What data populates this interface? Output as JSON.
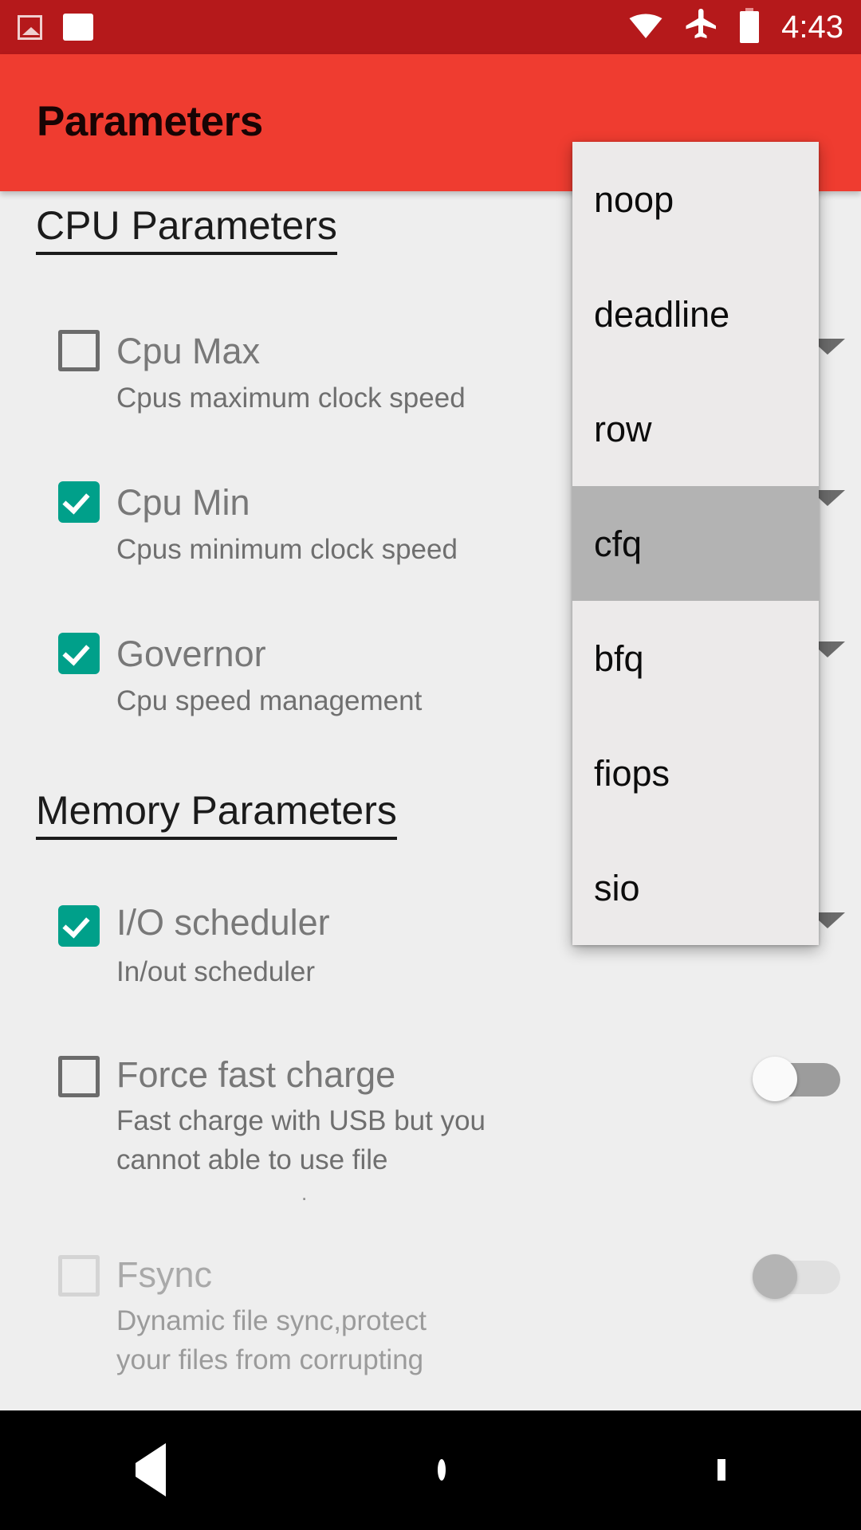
{
  "statusbar": {
    "time": "4:43",
    "icons": [
      "photo-icon",
      "white-square-icon",
      "wifi-icon",
      "airplane-mode-icon",
      "battery-icon"
    ]
  },
  "appbar": {
    "title": "Parameters"
  },
  "sections": [
    {
      "id": "cpu",
      "title": "CPU Parameters",
      "rows": [
        {
          "id": "cpu-max",
          "title": "Cpu Max",
          "subtitle": "Cpus maximum clock speed",
          "checked": false,
          "control": "spinner"
        },
        {
          "id": "cpu-min",
          "title": "Cpu Min",
          "subtitle": "Cpus minimum clock speed",
          "checked": true,
          "control": "spinner"
        },
        {
          "id": "governor",
          "title": "Governor",
          "subtitle": "Cpu speed management",
          "checked": true,
          "control": "spinner"
        }
      ]
    },
    {
      "id": "memory",
      "title": "Memory Parameters",
      "rows": [
        {
          "id": "io-scheduler",
          "title": "I/O scheduler",
          "subtitle": "In/out scheduler",
          "checked": true,
          "control": "spinner"
        },
        {
          "id": "force-fast-charge",
          "title": "Force fast charge",
          "subtitle": "Fast charge with USB but you\ncannot able to use file",
          "extra_dot": ".",
          "checked": false,
          "control": "switch",
          "switch_on": false,
          "switch_enabled": true
        },
        {
          "id": "fsync",
          "title": "Fsync",
          "subtitle": "Dynamic file sync,protect\nyour files from corrupting",
          "checked": false,
          "control": "switch",
          "switch_on": false,
          "switch_enabled": false
        }
      ]
    }
  ],
  "dropdown": {
    "name": "io-scheduler-options",
    "selected": "cfq",
    "options": [
      "noop",
      "deadline",
      "row",
      "cfq",
      "bfq",
      "fiops",
      "sio"
    ]
  },
  "navbar": {
    "back": "back-button",
    "home": "home-button",
    "recents": "recents-button"
  },
  "colors": {
    "statusbar": "#b5191b",
    "appbar": "#ef3c30",
    "accent_checkbox": "#00a08a",
    "background": "#eeeeee",
    "popup_bg": "#eceaea",
    "popup_selected": "#b3b3b3"
  }
}
